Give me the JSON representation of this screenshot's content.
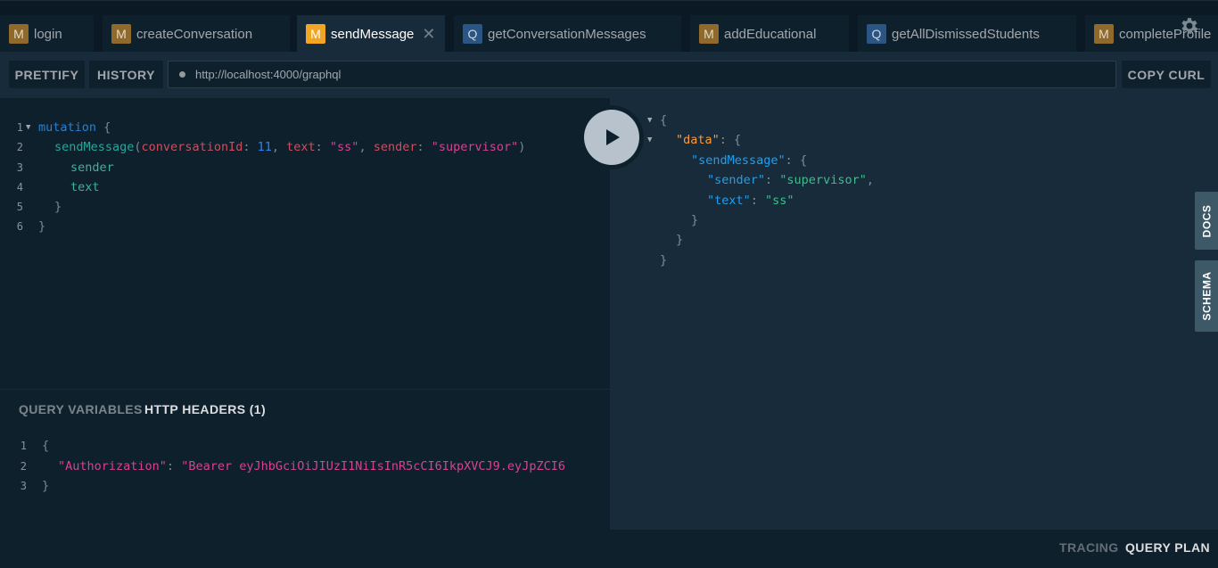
{
  "tabs": [
    {
      "badge": "M",
      "label": "login"
    },
    {
      "badge": "M",
      "label": "createConversation"
    },
    {
      "badge": "M",
      "label": "sendMessage",
      "close": "✕"
    },
    {
      "badge": "Q",
      "label": "getConversationMessages"
    },
    {
      "badge": "M",
      "label": "addEducational"
    },
    {
      "badge": "Q",
      "label": "getAllDismissedStudents"
    },
    {
      "badge": "M",
      "label": "completeProfile"
    }
  ],
  "toolbar": {
    "prettify": "PRETTIFY",
    "history": "HISTORY",
    "url": "http://localhost:4000/graphql",
    "copy_curl": "COPY CURL"
  },
  "editor": {
    "line_numbers": [
      "1",
      "2",
      "3",
      "4",
      "5",
      "6"
    ],
    "l1_kw": "mutation",
    "l1_brace": " {",
    "l2_fn": "sendMessage",
    "l2_open": "(",
    "arg1_name": "conversationId",
    "colon": ": ",
    "arg1_val": "11",
    "comma": ", ",
    "arg2_name": "text",
    "arg2_val": "\"ss\"",
    "arg3_name": "sender",
    "arg3_val": "\"supervisor\"",
    "l2_close": ")",
    "l3_field": "sender",
    "l4_field": "text",
    "l5": "}",
    "l6": "}"
  },
  "result": {
    "open": "{",
    "data_key": "\"data\"",
    "send_key": "\"sendMessage\"",
    "sender_key": "\"sender\"",
    "sender_val": "\"supervisor\"",
    "text_key": "\"text\"",
    "text_val": "\"ss\"",
    "colon": ": ",
    "brace_open": "{",
    "comma": ",",
    "close": "}"
  },
  "side_tabs": {
    "docs": "DOCS",
    "schema": "SCHEMA"
  },
  "variables": {
    "tab_query_variables": "QUERY VARIABLES",
    "tab_http_headers": "HTTP HEADERS (1)",
    "line_numbers": [
      "1",
      "2",
      "3"
    ],
    "open": "{",
    "auth_key": "\"Authorization\"",
    "auth_colon": ": ",
    "auth_val": "\"Bearer eyJhbGciOiJIUzI1NiIsInR5cCI6IkpXVCJ9.eyJpZCI6",
    "close": "}"
  },
  "footer": {
    "tracing": "TRACING",
    "query_plan": "QUERY PLAN"
  },
  "colors": {
    "accent_mutation": "#f2a523",
    "query_badge": "#2a5585",
    "background": "#0f202d",
    "panel": "#172b3a"
  },
  "icons": {
    "settings": "gear-icon",
    "run": "play-icon",
    "close": "close-icon"
  }
}
